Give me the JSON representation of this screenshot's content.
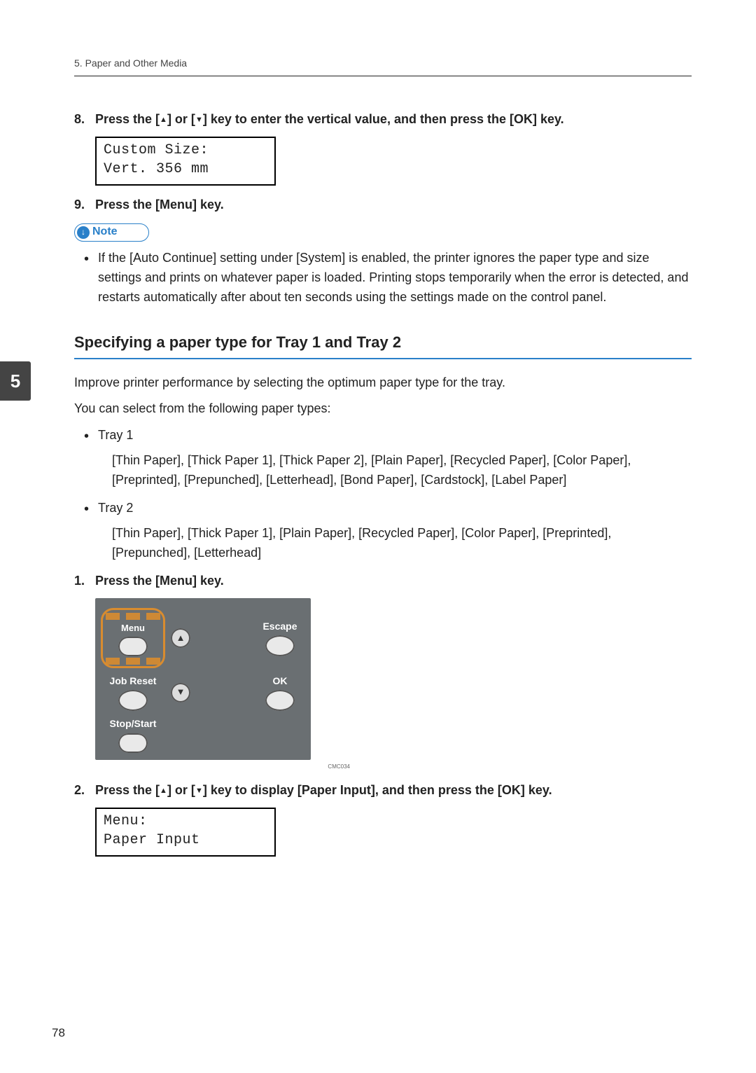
{
  "runhead": "5. Paper and Other Media",
  "chapter_tab": "5",
  "step8": {
    "num": "8.",
    "text_a": "Press the [",
    "text_b": "] or [",
    "text_c": "] key to enter the vertical value, and then press the [OK] key."
  },
  "lcd8": {
    "l1": "Custom Size:",
    "l2": "Vert. 356 mm"
  },
  "step9": {
    "num": "9.",
    "text": "Press the [Menu] key."
  },
  "note": {
    "label": "Note",
    "bullet": "If the [Auto Continue] setting under [System] is enabled, the printer ignores the paper type and size settings and prints on whatever paper is loaded. Printing stops temporarily when the error is detected, and restarts automatically after about ten seconds using the settings made on the control panel."
  },
  "section_title": "Specifying a paper type for Tray 1 and Tray 2",
  "intro1": "Improve printer performance by selecting the optimum paper type for the tray.",
  "intro2": "You can select from the following paper types:",
  "tray1": {
    "name": "Tray 1",
    "types": "[Thin Paper], [Thick Paper 1], [Thick Paper 2], [Plain Paper], [Recycled Paper], [Color Paper], [Preprinted], [Prepunched], [Letterhead], [Bond Paper], [Cardstock], [Label Paper]"
  },
  "tray2": {
    "name": "Tray 2",
    "types": "[Thin Paper], [Thick Paper 1], [Plain Paper], [Recycled Paper], [Color Paper], [Preprinted], [Prepunched], [Letterhead]"
  },
  "step1": {
    "num": "1.",
    "text": "Press the [Menu] key."
  },
  "panel": {
    "menu": "Menu",
    "escape": "Escape",
    "jobreset": "Job Reset",
    "ok": "OK",
    "stopstart": "Stop/Start"
  },
  "img_code": "CMC034",
  "step2": {
    "num": "2.",
    "text_a": "Press the [",
    "text_b": "] or [",
    "text_c": "] key to display [Paper Input], and then press the [OK] key."
  },
  "lcd2": {
    "l1": "Menu:",
    "l2": " Paper Input"
  },
  "page_number": "78"
}
